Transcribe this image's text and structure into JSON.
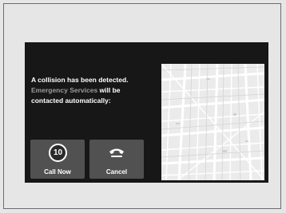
{
  "alert": {
    "line1": "A collision has been detected.",
    "line2_highlight": "Emergency Services",
    "line2_rest": " will be",
    "line3": "contacted automatically:"
  },
  "call_now": {
    "countdown": "10",
    "label": "Call Now"
  },
  "cancel": {
    "label": "Cancel",
    "icon": "phone-hangup-icon"
  },
  "colors": {
    "screen_bg": "#171717",
    "button_bg": "#515151",
    "highlight_text": "#9a9a9a"
  }
}
